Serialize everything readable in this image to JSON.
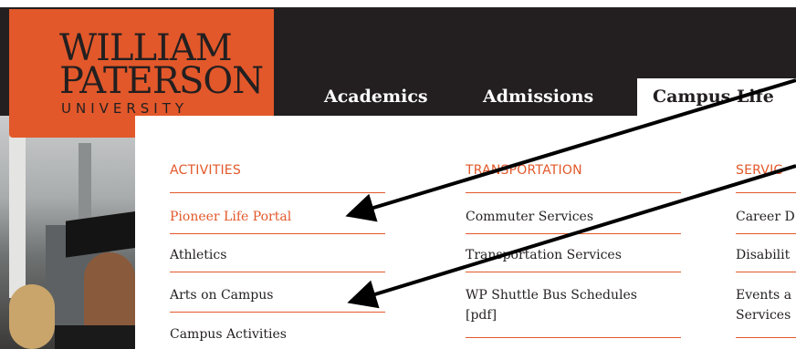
{
  "logo": {
    "line1": "WILLIAM",
    "line2": "PATERSON",
    "line3": "UNIVERSITY"
  },
  "nav": {
    "academics": "Academics",
    "admissions": "Admissions",
    "campus_life": "Campus Life"
  },
  "menu": {
    "activities": {
      "heading": "ACTIVITIES",
      "items": [
        "Pioneer Life Portal",
        "Athletics",
        "Arts on Campus",
        "Campus Activities"
      ]
    },
    "transportation": {
      "heading": "TRANSPORTATION",
      "items": [
        "Commuter Services",
        "Transportation Services",
        "WP Shuttle Bus Schedules",
        "[pdf]"
      ]
    },
    "services": {
      "heading": "SERVIC",
      "items": [
        "Career D",
        "Disabilit",
        "Events a",
        "Services"
      ]
    }
  },
  "colors": {
    "brand_orange": "#e2582a",
    "dark": "#231f20"
  }
}
